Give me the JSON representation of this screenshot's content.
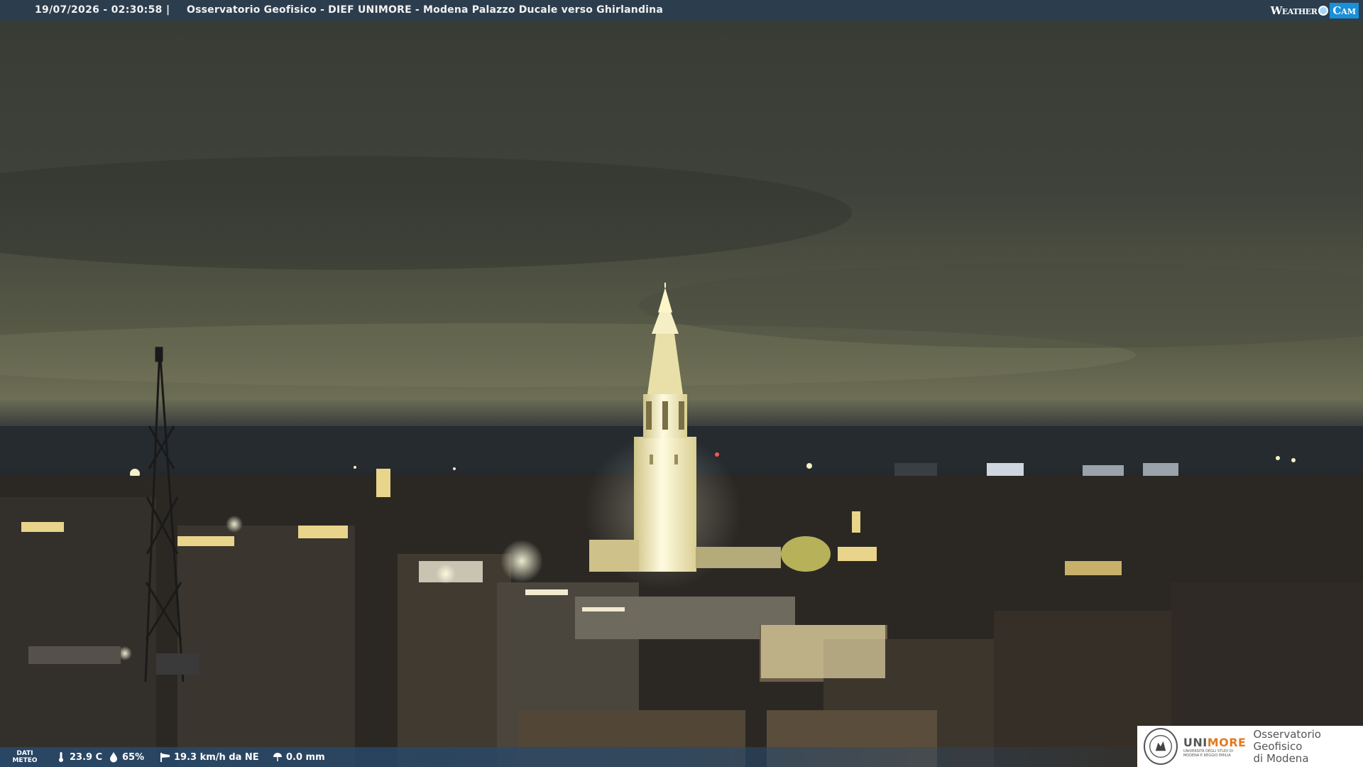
{
  "header": {
    "timestamp": "19/07/2026 - 02:30:58",
    "separator": "|",
    "title": "Osservatorio Geofisico - DIEF UNIMORE - Modena Palazzo Ducale verso Ghirlandina"
  },
  "brand": {
    "weather": "Weather",
    "cam": "Cam"
  },
  "footer": {
    "dati_line1": "DATI",
    "dati_line2": "METEO",
    "temperature": "23.9 C",
    "humidity": "65%",
    "wind": "19.3 km/h da NE",
    "rain": "0.0 mm"
  },
  "logo": {
    "uni_prefix": "UNI",
    "uni_suffix": "MORE",
    "uni_sub": "UNIVERSITÀ DEGLI STUDI DI MODENA E REGGIO EMILIA",
    "obs_line1": "Osservatorio Geofisico",
    "obs_line2": "di Modena"
  },
  "colors": {
    "bar": "#2a3e54",
    "accent": "#1b8fd8",
    "unimore_orange": "#e07b1f",
    "tower_light": "#fff6c8"
  },
  "icons": {
    "temperature": "thermometer-icon",
    "humidity": "droplet-icon",
    "wind": "windsock-icon",
    "rain": "rain-gauge-icon"
  }
}
